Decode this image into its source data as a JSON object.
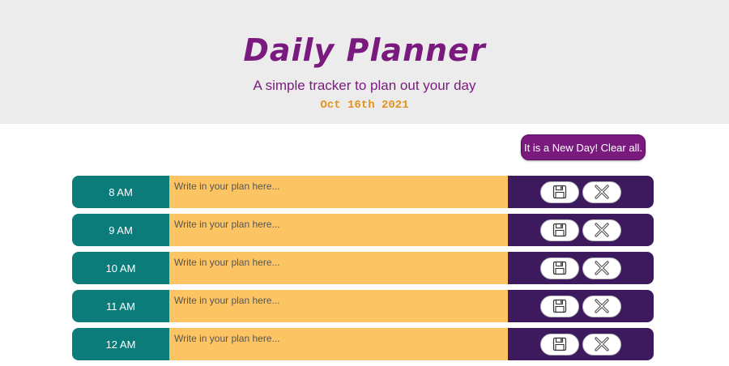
{
  "header": {
    "title": "Daily Planner",
    "subtitle": "A simple tracker to plan out your day",
    "date": "Oct 16th 2021"
  },
  "clear_button": {
    "label": "It is a New Day! Clear all."
  },
  "plan_placeholder": "Write in your plan here...",
  "hours": [
    {
      "label": "8 AM",
      "value": ""
    },
    {
      "label": "9 AM",
      "value": ""
    },
    {
      "label": "10 AM",
      "value": ""
    },
    {
      "label": "11 AM",
      "value": ""
    },
    {
      "label": "12 AM",
      "value": ""
    }
  ],
  "icons": {
    "save": "floppy-disk-icon",
    "delete": "close-x-icon"
  },
  "colors": {
    "header_bg": "#ececec",
    "title": "#7b1a7e",
    "date": "#e2941f",
    "hour_bg": "#0b7c7a",
    "plan_bg": "#fcc462",
    "actions_bg": "#3d1a5e",
    "clear_button_bg": "#7b1a7e"
  }
}
